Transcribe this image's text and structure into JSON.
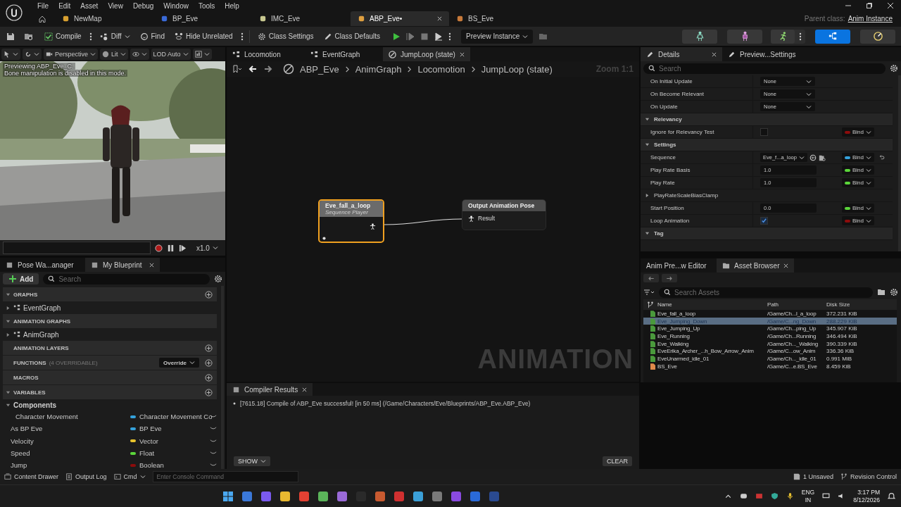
{
  "menu": [
    "File",
    "Edit",
    "Asset",
    "View",
    "Debug",
    "Window",
    "Tools",
    "Help"
  ],
  "doc_tabs": [
    {
      "label": "NewMap",
      "selected": false
    },
    {
      "label": "BP_Eve",
      "selected": false
    },
    {
      "label": "IMC_Eve",
      "selected": false
    },
    {
      "label": "ABP_Eve•",
      "selected": true
    },
    {
      "label": "BS_Eve",
      "selected": false
    }
  ],
  "parent_class": {
    "label": "Parent class:",
    "value": "Anim Instance"
  },
  "toolbar": {
    "compile": "Compile",
    "diff": "Diff",
    "find": "Find",
    "hide_unrelated": "Hide Unrelated",
    "class_settings": "Class Settings",
    "class_defaults": "Class Defaults",
    "preview_instance": "Preview Instance"
  },
  "viewport": {
    "perspective": "Perspective",
    "lit": "Lit",
    "lod": "LOD Auto",
    "notice": [
      "Previewing ABP_Eve_C.",
      "Bone manipulation is disabled in this mode."
    ],
    "speed": "x1.0"
  },
  "left_tabs": [
    {
      "label": "Pose Wa...anager",
      "selected": false
    },
    {
      "label": "My Blueprint",
      "selected": true
    }
  ],
  "my_blueprint": {
    "add": "Add",
    "search_placeholder": "Search",
    "sections": [
      {
        "title": "GRAPHS",
        "expanded": true,
        "add_button": true,
        "items": [
          "EventGraph"
        ]
      },
      {
        "title": "ANIMATION GRAPHS",
        "expanded": true,
        "add_button": false,
        "items": [
          "AnimGraph"
        ]
      },
      {
        "title": "ANIMATION LAYERS",
        "add_button": true
      },
      {
        "title": "FUNCTIONS",
        "note": "(4 OVERRIDABLE)",
        "dropdown": "Override",
        "add_button": true
      },
      {
        "title": "MACROS",
        "add_button": true
      },
      {
        "title": "VARIABLES",
        "expanded": true,
        "add_button": true
      }
    ],
    "variable_categories": [
      {
        "name": "Components",
        "expanded": true,
        "children": [
          {
            "name": "Character Movement",
            "type": "Character Movement Co",
            "color": "#35a2dc"
          }
        ]
      }
    ],
    "variables": [
      {
        "name": "As BP Eve",
        "type": "BP Eve",
        "color": "#35a2dc"
      },
      {
        "name": "Velocity",
        "type": "Vector",
        "color": "#e8c32c"
      },
      {
        "name": "Speed",
        "type": "Float",
        "color": "#5bd63a"
      },
      {
        "name": "Jump",
        "type": "Boolean",
        "color": "#8c0c0c"
      }
    ]
  },
  "graph_tabs": [
    {
      "label": "Locomotion",
      "selected": false
    },
    {
      "label": "EventGraph",
      "selected": false
    },
    {
      "label": "JumpLoop (state)",
      "selected": true
    }
  ],
  "breadcrumb": [
    "ABP_Eve",
    "AnimGraph",
    "Locomotion",
    "JumpLoop (state)"
  ],
  "zoom": "Zoom 1:1",
  "nodes": [
    {
      "title": "Eve_fall_a_loop",
      "subtitle": "Sequence Player",
      "selected": true
    },
    {
      "title": "Output Animation Pose",
      "pin": "Result",
      "selected": false
    }
  ],
  "graph_watermark": "ANIMATION",
  "compiler": {
    "tab": "Compiler Results",
    "messages": [
      "[7615.18] Compile of ABP_Eve successful! [in 50 ms] (/Game/Characters/Eve/Blueprints/ABP_Eve.ABP_Eve)"
    ],
    "show": "SHOW",
    "clear": "CLEAR"
  },
  "details_tabs": [
    {
      "label": "Details",
      "selected": true
    },
    {
      "label": "Preview...Settings",
      "selected": false
    }
  ],
  "details_search": {
    "placeholder": "Search"
  },
  "details_rows": [
    {
      "kind": "dropdown",
      "label": "On Initial Update",
      "value": "None"
    },
    {
      "kind": "dropdown",
      "label": "On Become Relevant",
      "value": "None"
    },
    {
      "kind": "dropdown",
      "label": "On Update",
      "value": "None"
    },
    {
      "kind": "category",
      "label": "Relevancy",
      "expanded": true
    },
    {
      "kind": "checkbox",
      "label": "Ignore for Relevancy Test",
      "checked": false,
      "bind": "Bind",
      "color": "#8c0c0c"
    },
    {
      "kind": "category",
      "label": "Settings",
      "expanded": true
    },
    {
      "kind": "asset",
      "label": "Sequence",
      "value": "Eve_f...a_loop",
      "bind": "Bind",
      "color": "#35a2dc"
    },
    {
      "kind": "number",
      "label": "Play Rate Basis",
      "value": "1.0",
      "bind": "Bind",
      "color": "#5bd63a"
    },
    {
      "kind": "number",
      "label": "Play Rate",
      "value": "1.0",
      "bind": "Bind",
      "color": "#5bd63a"
    },
    {
      "kind": "group",
      "label": "PlayRateScaleBiasClamp",
      "expanded": false
    },
    {
      "kind": "number",
      "label": "Start Position",
      "value": "0.0",
      "bind": "Bind",
      "color": "#5bd63a"
    },
    {
      "kind": "checkbox",
      "label": "Loop Animation",
      "checked": true,
      "bind": "Bind",
      "color": "#8c0c0c"
    },
    {
      "kind": "category",
      "label": "Tag",
      "expanded": true
    }
  ],
  "asset_tabs": [
    {
      "label": "Anim Pre...w Editor",
      "selected": false
    },
    {
      "label": "Asset Browser",
      "selected": true
    }
  ],
  "asset_search": {
    "placeholder": "Search Assets"
  },
  "asset_columns": [
    "Name",
    "Path",
    "Disk Size"
  ],
  "assets": [
    {
      "name": "Eve_fall_a_loop",
      "path": "/Game/Ch...l_a_loop",
      "size": "372.231 KiB",
      "color": "#4a9a3c",
      "selected": false
    },
    {
      "name": "Eve_Jumping_Down",
      "path": "/Game/C...ng_Down",
      "size": "288.229 KiB",
      "color": "#4a9a3c",
      "selected": true
    },
    {
      "name": "Eve_Jumping_Up",
      "path": "/Game/Ch...ping_Up",
      "size": "345.907 KiB",
      "color": "#4a9a3c",
      "selected": false
    },
    {
      "name": "Eve_Running",
      "path": "/Game/Ch...Running",
      "size": "346.494 KiB",
      "color": "#4a9a3c",
      "selected": false
    },
    {
      "name": "Eve_Walking",
      "path": "/Game/Ch..._Walking",
      "size": "390.339 KiB",
      "color": "#4a9a3c",
      "selected": false
    },
    {
      "name": "EveErika_Archer_...h_Bow_Arrow_Anim",
      "path": "/Game/C...ow_Anim",
      "size": "336.36 KiB",
      "color": "#4a9a3c",
      "selected": false
    },
    {
      "name": "EveUnarmed_idle_01",
      "path": "/Game/Ch..._idle_01",
      "size": "0.991 MiB",
      "color": "#4a9a3c",
      "selected": false
    },
    {
      "name": "BS_Eve",
      "path": "/Game/C...e.BS_Eve",
      "size": "8.459 KiB",
      "color": "#e08a4a",
      "selected": false
    }
  ],
  "status_bar": {
    "content_drawer": "Content Drawer",
    "output_log": "Output Log",
    "cmd": "Cmd",
    "console_placeholder": "Enter Console Command",
    "unsaved": "1 Unsaved",
    "revision": "Revision Control"
  },
  "taskbar": {
    "lang": [
      "ENG",
      "IN"
    ],
    "time": "3:17 PM",
    "date": "8/12/2026"
  }
}
